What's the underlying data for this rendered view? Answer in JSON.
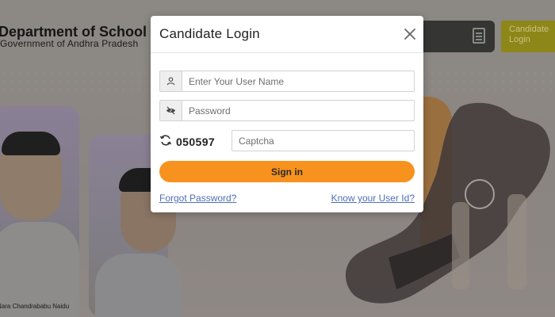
{
  "background": {
    "department_title": "Department of School Education",
    "government_subtitle": "Government of Andhra Pradesh",
    "candidate_login_button": "Candidate Login",
    "photo_caption": "Nara Chandrababu Naidu"
  },
  "modal": {
    "title": "Candidate Login",
    "username_placeholder": "Enter Your User Name",
    "password_placeholder": "Password",
    "captcha_code": "050597",
    "captcha_placeholder": "Captcha",
    "signin_label": "Sign in",
    "forgot_password_label": "Forgot Password?",
    "know_user_id_label": "Know your User Id?"
  },
  "colors": {
    "accent_orange": "#f7921e",
    "link_blue": "#4d6fb8",
    "overlay_dim": "#8d8783"
  },
  "icons": {
    "close": "close-icon",
    "user": "user-icon",
    "eye": "eye-slash-icon",
    "refresh": "refresh-icon",
    "document": "document-icon"
  }
}
